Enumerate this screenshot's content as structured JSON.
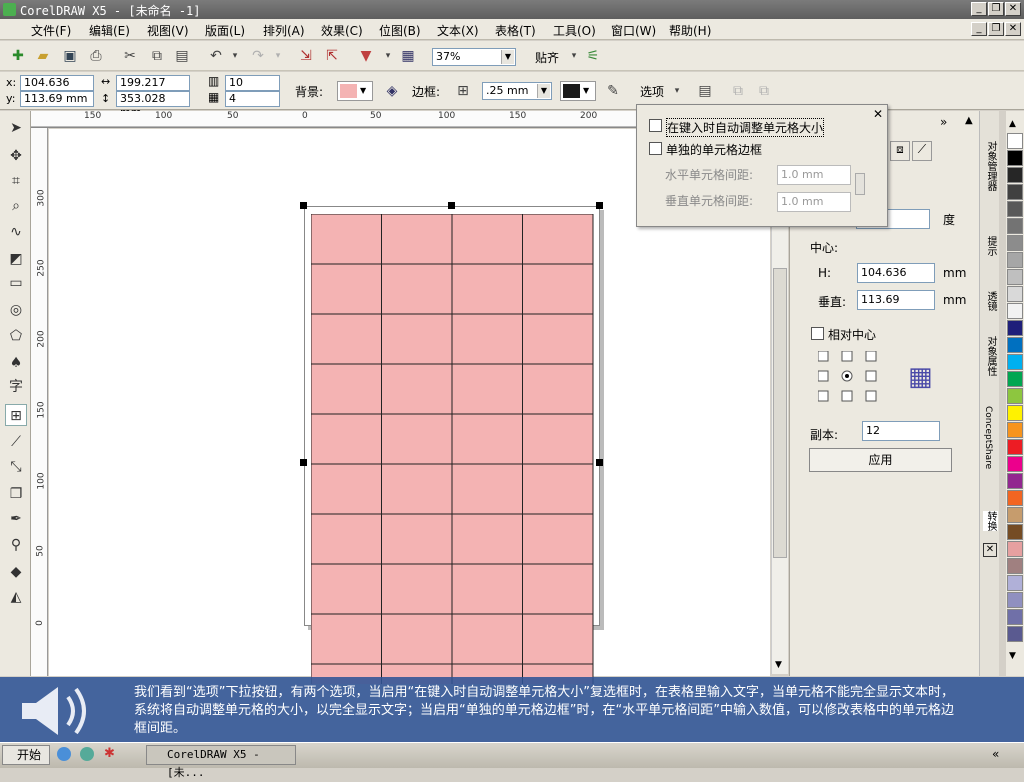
{
  "window": {
    "title": "CorelDRAW X5 - [未命名 -1]"
  },
  "menu": [
    "文件(F)",
    "编辑(E)",
    "视图(V)",
    "版面(L)",
    "排列(A)",
    "效果(C)",
    "位图(B)",
    "文本(X)",
    "表格(T)",
    "工具(O)",
    "窗口(W)",
    "帮助(H)"
  ],
  "toolbar": {
    "zoom": "37%",
    "snap_label": "贴齐"
  },
  "props": {
    "x_label": "x:",
    "y_label": "y:",
    "x": "104.636 mm",
    "y": "113.69 mm",
    "width": "199.217 mm",
    "height": "353.028 mm",
    "rows": "10",
    "cols": "4",
    "bg_label": "背景:",
    "border_label": "边框:",
    "border_width": ".25 mm",
    "options_label": "选项"
  },
  "ruler": {
    "top": [
      "150",
      "100",
      "50",
      "0",
      "50",
      "100",
      "150",
      "200"
    ],
    "left": [
      "300",
      "250",
      "200",
      "150",
      "100",
      "50",
      "0"
    ]
  },
  "table": {
    "fill": "#f4b3b3",
    "rows": 10,
    "cols": 4
  },
  "popup": {
    "opt1": "在键入时自动调整单元格大小",
    "opt2": "单独的单元格边框",
    "hspace_label": "水平单元格间距:",
    "vspace_label": "垂直单元格间距:",
    "hspace": "1.0 mm",
    "vspace": "1.0 mm"
  },
  "docker": {
    "angle_unit": "度",
    "center_label": "中心:",
    "h_label": "H:",
    "h_value": "104.636",
    "v_label": "垂直:",
    "v_value": "113.69",
    "unit": "mm",
    "relative_label": "相对中心",
    "copies_label": "副本:",
    "copies": "12",
    "apply": "应用"
  },
  "docker_tabs": [
    "对象管理器",
    "提示",
    "透镜",
    "对象属性",
    "ConceptShare",
    "转换"
  ],
  "palette": [
    "#ffffff",
    "#000000",
    "#262626",
    "#404040",
    "#595959",
    "#737373",
    "#8c8c8c",
    "#a6a6a6",
    "#bfbfbf",
    "#d9d9d9",
    "#f2f2f2",
    "#1f1f7a",
    "#0070c0",
    "#00b0f0",
    "#00a651",
    "#8dc63f",
    "#fff200",
    "#f7941d",
    "#ed1c24",
    "#ec008c",
    "#92278f",
    "#f26522",
    "#c69c6d",
    "#754c24",
    "#e6a0a0",
    "#a08080",
    "#b0b0d8",
    "#9090c0",
    "#7070a8",
    "#5a5a90"
  ],
  "caption": "我们看到“选项”下拉按钮，有两个选项，当启用“在键入时自动调整单元格大小”复选框时，在表格里输入文字，当单元格不能完全显示文本时，系统将自动调整单元格的大小，以完全显示文字；当启用“单独的单元格边框”时，在“水平单元格间距”中输入数值，可以修改表格中的单元格边框间距。",
  "taskbar": {
    "start": "开始",
    "task": "CorelDRAW X5 - [未..."
  }
}
